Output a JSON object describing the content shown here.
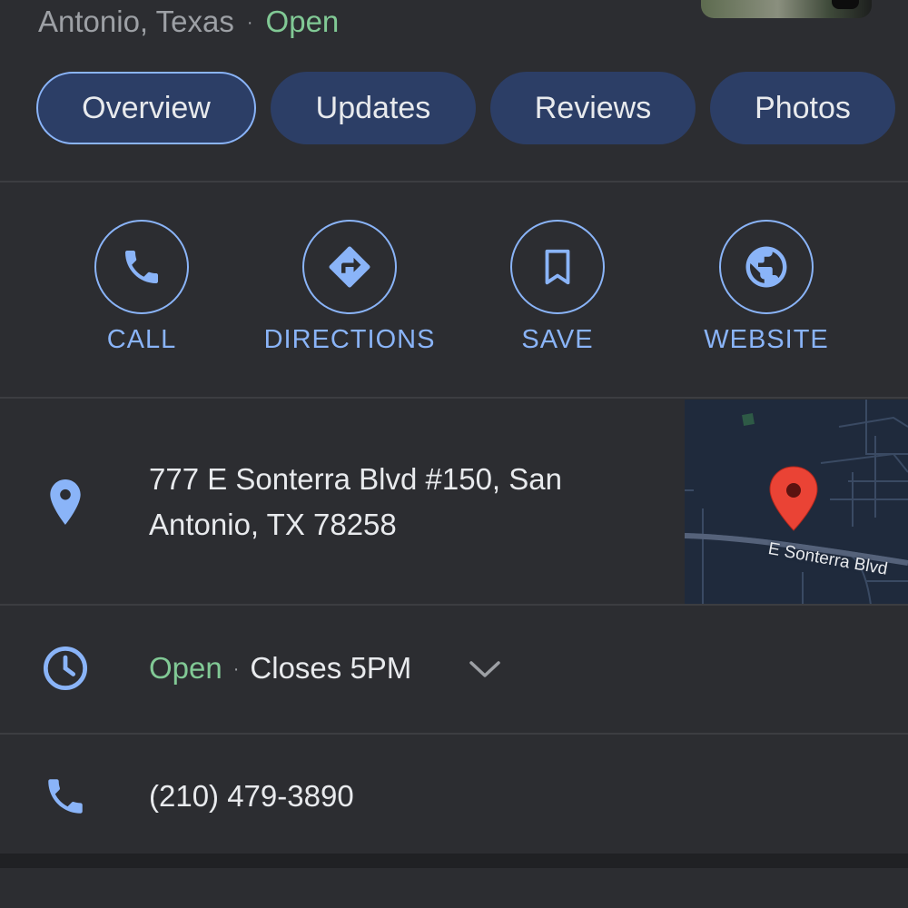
{
  "header": {
    "location": "Antonio, Texas",
    "separator": "·",
    "status": "Open"
  },
  "tabs": [
    {
      "label": "Overview",
      "active": true
    },
    {
      "label": "Updates",
      "active": false
    },
    {
      "label": "Reviews",
      "active": false
    },
    {
      "label": "Photos",
      "active": false
    }
  ],
  "actions": [
    {
      "label": "CALL",
      "icon": "phone-icon"
    },
    {
      "label": "DIRECTIONS",
      "icon": "directions-icon"
    },
    {
      "label": "SAVE",
      "icon": "bookmark-icon"
    },
    {
      "label": "WEBSITE",
      "icon": "globe-icon"
    }
  ],
  "address": {
    "line1": "777 E Sonterra Blvd #150, San",
    "line2": "Antonio, TX 78258",
    "icon": "location-pin-icon",
    "map_street_label": "E Sonterra Blvd"
  },
  "hours": {
    "status": "Open",
    "separator": "·",
    "closes": "Closes 5PM",
    "icon": "clock-icon"
  },
  "phone": {
    "number": "(210) 479-3890",
    "icon": "phone-icon"
  },
  "colors": {
    "background": "#2c2d31",
    "accent": "#8ab4f8",
    "open_green": "#81c995",
    "tab_bg": "#2c3e66",
    "map_pin": "#ea4335"
  }
}
